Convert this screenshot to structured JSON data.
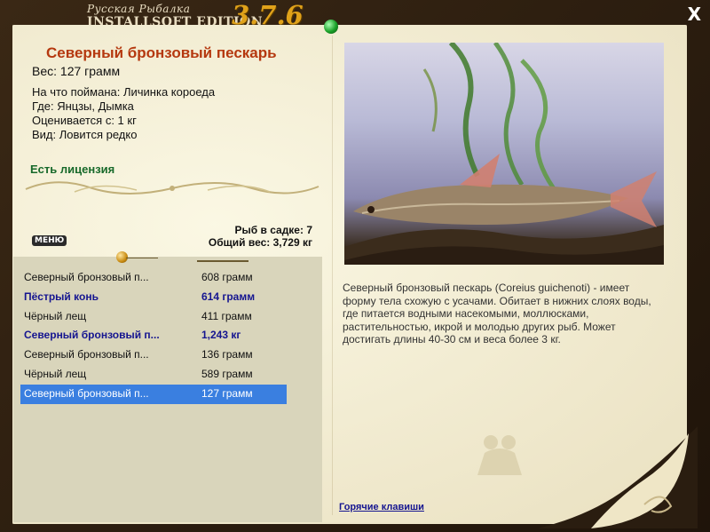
{
  "app": {
    "title_ru": "Русская Рыбалка",
    "title_en": "INSTALLSOFT EDITION",
    "version": "3.7.6",
    "close_label": "X"
  },
  "fish": {
    "name": "Северный бронзовый пескарь",
    "weight": "Вес: 127 грамм",
    "bait": "На что поймана: Личинка короеда",
    "location": "Где: Янцзы, Дымка",
    "valued": "Оценивается с: 1 кг",
    "kind": "Вид: Ловится редко",
    "license": "Есть лицензия"
  },
  "stats": {
    "in_keepnet": "Рыб в садке: 7",
    "total_weight": "Общий вес: 3,729 кг"
  },
  "menu_label": "МЕНЮ",
  "catches": [
    {
      "name": "Северный бронзовый п...",
      "weight": "608 грамм",
      "bold": false,
      "selected": false
    },
    {
      "name": "Пёстрый конь",
      "weight": "614 грамм",
      "bold": true,
      "selected": false
    },
    {
      "name": "Чёрный лещ",
      "weight": "411 грамм",
      "bold": false,
      "selected": false
    },
    {
      "name": "Северный бронзовый п...",
      "weight": "1,243 кг",
      "bold": true,
      "selected": false
    },
    {
      "name": "Северный бронзовый п...",
      "weight": "136 грамм",
      "bold": false,
      "selected": false
    },
    {
      "name": "Чёрный лещ",
      "weight": "589 грамм",
      "bold": false,
      "selected": false
    },
    {
      "name": "Северный бронзовый п...",
      "weight": "127 грамм",
      "bold": false,
      "selected": true
    }
  ],
  "description": "Северный бронзовый пескарь (Coreius guichenoti) - имеет форму тела схожую с усачами. Обитает в нижних слоях воды, где питается водными насекомыми, моллюсками, растительностью, икрой и молодью других рыб. Может достигать длины 40-30 см и веса более 3 кг.",
  "hotkeys_label": "Горячие клавиши",
  "colors": {
    "fish_name": "#b5380f",
    "license": "#17692a",
    "highlight_row": "#151590",
    "selection": "#3a7fe0",
    "version": "#e0a21a"
  },
  "icons": [
    "close-icon",
    "pin-icon",
    "green-pin-icon",
    "fish-photo",
    "ornament",
    "page-curl",
    "watermark-icon"
  ]
}
